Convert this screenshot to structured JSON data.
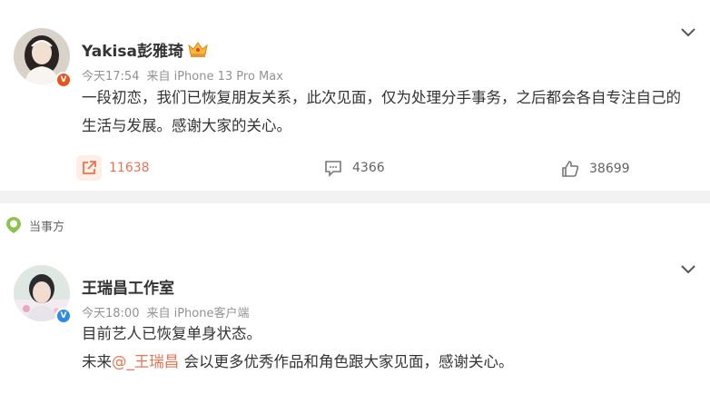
{
  "post1": {
    "author": "Yakisa彭雅琦",
    "time": "今天17:54",
    "source": "来自 iPhone 13 Pro Max",
    "text": "一段初恋，我们已恢复朋友关系，此次见面，仅为处理分手事务，之后都会各自专注自己的生活与发展。感谢大家的关心。",
    "reposts": "11638",
    "comments": "4366",
    "likes": "38699",
    "badge": "V"
  },
  "tag": {
    "label": "当事方"
  },
  "post2": {
    "author": "王瑞昌工作室",
    "time": "今天18:00",
    "source": "来自 iPhone客户端",
    "line1": "目前艺人已恢复单身状态。",
    "line2_pre": "未来",
    "mention": "@_王瑞昌",
    "line2_post": " 会以更多优秀作品和角色跟大家见面，感谢关心。",
    "badge": "V"
  },
  "colors": {
    "accent": "#eb7350",
    "verified_red": "#e8541e",
    "verified_blue": "#2c8ae8",
    "meta_gray": "#939393",
    "tag_green": "#8bc34a"
  },
  "icons": [
    "chevron-down-icon",
    "crown-icon",
    "repost-icon",
    "comment-icon",
    "like-icon",
    "location-pin-icon",
    "verified-icon"
  ]
}
